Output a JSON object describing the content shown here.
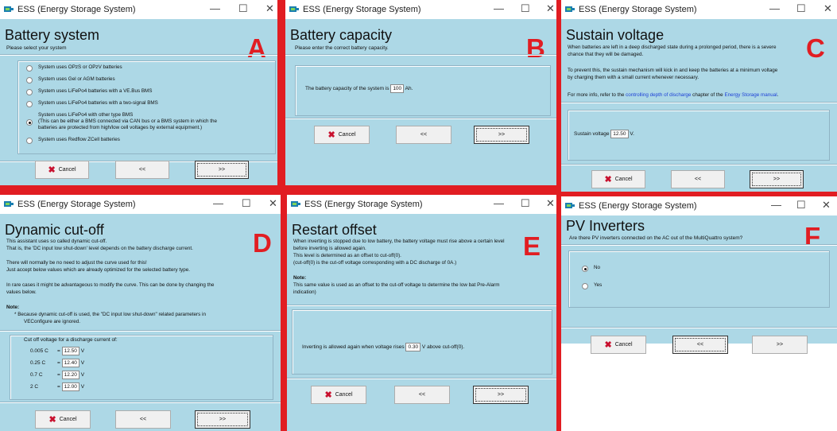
{
  "common": {
    "window_title": "ESS (Energy Storage System)",
    "minimize": "—",
    "maximize": "☐",
    "close": "✕",
    "cancel": "Cancel",
    "back": "<<",
    "next": ">>"
  },
  "A": {
    "letter": "A",
    "heading": "Battery system",
    "sub": "Please select your system",
    "options": [
      "System uses OPzS or OPzV batteries",
      "System uses Gel or AGM batteries",
      "System uses LiFePo4 batteries with a VE.Bus BMS",
      "System uses LiFePo4 batteries with a two-signal BMS",
      "System uses LiFePo4 with other type BMS",
      "(This can be either a BMS connected via CAN bus or a BMS system in which the",
      "batteries are protected from high/low cell voltages by external equipment.)",
      "System uses Redflow ZCell batteries"
    ],
    "selected_index": 4
  },
  "B": {
    "letter": "B",
    "heading": "Battery capacity",
    "sub": "Please enter the correct battery capacity.",
    "text_before": "The battery capacity of the system is",
    "value": "100",
    "unit": "Ah."
  },
  "C": {
    "letter": "C",
    "heading": "Sustain voltage",
    "p1a": "When batteries are left in a deep discharged state during a prolonged period, there is a severe",
    "p1b": "chance that they will be damaged.",
    "p2a": "To prevent this, the sustain mechanism will kick in and keep the batteries at a minimum voltage",
    "p2b": "by charging them with a small current whenever necessary.",
    "p3_pre": "For more info, refer to the",
    "p3_link1": "controlling depth of discharge",
    "p3_mid": "chapter of the",
    "p3_link2": "Energy Storage manual",
    "label": "Sustain voltage",
    "value": "12.50",
    "unit": "V."
  },
  "D": {
    "letter": "D",
    "heading": "Dynamic cut-off",
    "l1": "This assistant uses so called dynamic cut-off.",
    "l2": "That is, the 'DC input low shut-down' level depends on the battery discharge current.",
    "l3": "There will normally be no need to adjust the curve used for this!",
    "l4": "Just accept below values which are already optimized for the selected battery type.",
    "l5": "In rare cases it might be advantageous to modify the curve. This can be done by changing the",
    "l6": "values below.",
    "note": "Note:",
    "n1": "* Because dynamic cut-off is used, the \"DC input low shut-down\" related parameters in",
    "n2": "VEConfigure are ignored.",
    "group_label": "Cut off voltage for a discharge current of:",
    "rows": [
      {
        "c": "0.005 C",
        "v": "12.50"
      },
      {
        "c": "0.25 C",
        "v": "12.40"
      },
      {
        "c": "0.7 C",
        "v": "12.20"
      },
      {
        "c": "2 C",
        "v": "12.00"
      }
    ],
    "eq": "=",
    "unit": "V"
  },
  "E": {
    "letter": "E",
    "heading": "Restart offset",
    "l1": "When inverting is stopped due to low battery, the battery voltage must rise above a certain level",
    "l2": "before inverting is allowed again.",
    "l3": "This level is determined as an offset to cut-off(0).",
    "l4": "(cut-off(0) is the cut-off voltage corresponding with a DC discharge of 0A.)",
    "note": "Note:",
    "n1": "This same value is used as an offset to the cut-off voltage to determine the low bat Pre-Alarm",
    "n2": "indication)",
    "text_before": "Inverting is allowed again when voltage rises",
    "value": "0.30",
    "text_after": "V above cut-off(0)."
  },
  "F": {
    "letter": "F",
    "heading": "PV Inverters",
    "sub": "Are there PV inverters connected on the AC out of the MultiQuattro system?",
    "options": [
      "No",
      "Yes"
    ],
    "selected_index": 0
  }
}
